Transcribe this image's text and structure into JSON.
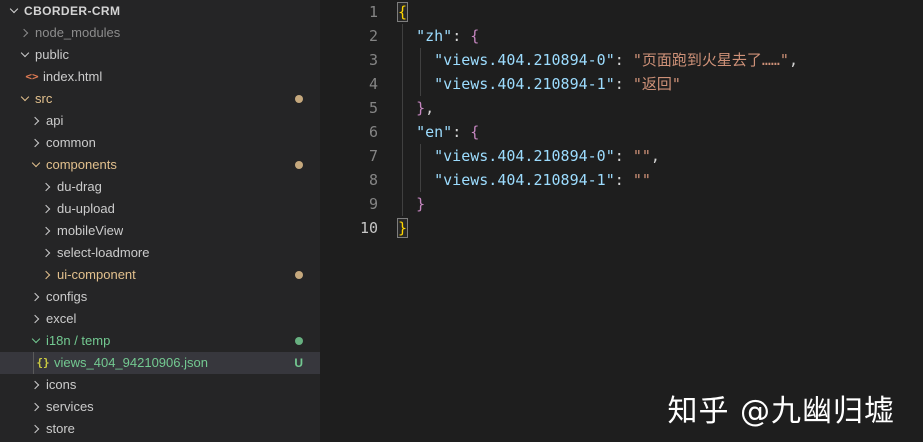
{
  "explorer": {
    "root": {
      "label": "CBORDER-CRM"
    },
    "items": [
      {
        "id": "node-modules",
        "label": "node_modules",
        "depth": 1,
        "kind": "folder",
        "chevron": "right",
        "color": "ignored"
      },
      {
        "id": "public",
        "label": "public",
        "depth": 1,
        "kind": "folder",
        "chevron": "down",
        "color": "normal"
      },
      {
        "id": "index-html",
        "label": "index.html",
        "depth": 2,
        "kind": "file",
        "icon": "html",
        "color": "normal"
      },
      {
        "id": "src",
        "label": "src",
        "depth": 1,
        "kind": "folder",
        "chevron": "down",
        "color": "modified",
        "badge": "dot"
      },
      {
        "id": "api",
        "label": "api",
        "depth": 2,
        "kind": "folder",
        "chevron": "right",
        "color": "normal"
      },
      {
        "id": "common",
        "label": "common",
        "depth": 2,
        "kind": "folder",
        "chevron": "right",
        "color": "normal"
      },
      {
        "id": "components",
        "label": "components",
        "depth": 2,
        "kind": "folder",
        "chevron": "down",
        "color": "modified",
        "badge": "dot"
      },
      {
        "id": "du-drag",
        "label": "du-drag",
        "depth": 3,
        "kind": "folder",
        "chevron": "right",
        "color": "normal"
      },
      {
        "id": "du-upload",
        "label": "du-upload",
        "depth": 3,
        "kind": "folder",
        "chevron": "right",
        "color": "normal"
      },
      {
        "id": "mobileview",
        "label": "mobileView",
        "depth": 3,
        "kind": "folder",
        "chevron": "right",
        "color": "normal"
      },
      {
        "id": "select-loadmore",
        "label": "select-loadmore",
        "depth": 3,
        "kind": "folder",
        "chevron": "right",
        "color": "normal"
      },
      {
        "id": "ui-component",
        "label": "ui-component",
        "depth": 3,
        "kind": "folder",
        "chevron": "right",
        "color": "modified",
        "badge": "dot"
      },
      {
        "id": "configs",
        "label": "configs",
        "depth": 2,
        "kind": "folder",
        "chevron": "right",
        "color": "normal"
      },
      {
        "id": "excel",
        "label": "excel",
        "depth": 2,
        "kind": "folder",
        "chevron": "right",
        "color": "normal"
      },
      {
        "id": "i18n-temp",
        "label": "i18n / temp",
        "depth": 2,
        "kind": "folder",
        "chevron": "down",
        "color": "untracked",
        "badge": "dot"
      },
      {
        "id": "views-404-json",
        "label": "views_404_94210906.json",
        "depth": 3,
        "kind": "file",
        "icon": "json",
        "color": "untracked",
        "badge": "U",
        "selected": true
      },
      {
        "id": "icons",
        "label": "icons",
        "depth": 2,
        "kind": "folder",
        "chevron": "right",
        "color": "normal"
      },
      {
        "id": "services",
        "label": "services",
        "depth": 2,
        "kind": "folder",
        "chevron": "right",
        "color": "normal"
      },
      {
        "id": "store",
        "label": "store",
        "depth": 2,
        "kind": "folder",
        "chevron": "right",
        "color": "normal"
      }
    ]
  },
  "icons": {
    "html": "<>",
    "json": "{}"
  },
  "editor": {
    "lines": [
      {
        "num": "1",
        "active": false,
        "tokens": [
          {
            "text": "{",
            "style": "b1",
            "match": true
          }
        ]
      },
      {
        "num": "2",
        "active": false,
        "tokens": [
          {
            "text": "  ",
            "style": "p"
          },
          {
            "text": "\"zh\"",
            "style": "key"
          },
          {
            "text": ": ",
            "style": "p"
          },
          {
            "text": "{",
            "style": "b2"
          }
        ]
      },
      {
        "num": "3",
        "active": false,
        "tokens": [
          {
            "text": "    ",
            "style": "p"
          },
          {
            "text": "\"views.404.210894-0\"",
            "style": "key"
          },
          {
            "text": ": ",
            "style": "p"
          },
          {
            "text": "\"页面跑到火星去了……\"",
            "style": "str"
          },
          {
            "text": ",",
            "style": "p"
          }
        ]
      },
      {
        "num": "4",
        "active": false,
        "tokens": [
          {
            "text": "    ",
            "style": "p"
          },
          {
            "text": "\"views.404.210894-1\"",
            "style": "key"
          },
          {
            "text": ": ",
            "style": "p"
          },
          {
            "text": "\"返回\"",
            "style": "str"
          }
        ]
      },
      {
        "num": "5",
        "active": false,
        "tokens": [
          {
            "text": "  ",
            "style": "p"
          },
          {
            "text": "}",
            "style": "b2"
          },
          {
            "text": ",",
            "style": "p"
          }
        ]
      },
      {
        "num": "6",
        "active": false,
        "tokens": [
          {
            "text": "  ",
            "style": "p"
          },
          {
            "text": "\"en\"",
            "style": "key"
          },
          {
            "text": ": ",
            "style": "p"
          },
          {
            "text": "{",
            "style": "b2"
          }
        ]
      },
      {
        "num": "7",
        "active": false,
        "tokens": [
          {
            "text": "    ",
            "style": "p"
          },
          {
            "text": "\"views.404.210894-0\"",
            "style": "key"
          },
          {
            "text": ": ",
            "style": "p"
          },
          {
            "text": "\"\"",
            "style": "str"
          },
          {
            "text": ",",
            "style": "p"
          }
        ]
      },
      {
        "num": "8",
        "active": false,
        "tokens": [
          {
            "text": "    ",
            "style": "p"
          },
          {
            "text": "\"views.404.210894-1\"",
            "style": "key"
          },
          {
            "text": ": ",
            "style": "p"
          },
          {
            "text": "\"\"",
            "style": "str"
          }
        ]
      },
      {
        "num": "9",
        "active": false,
        "tokens": [
          {
            "text": "  ",
            "style": "p"
          },
          {
            "text": "}",
            "style": "b2"
          }
        ]
      },
      {
        "num": "10",
        "active": true,
        "tokens": [
          {
            "text": "}",
            "style": "b1",
            "match": true
          }
        ]
      }
    ]
  },
  "watermark": {
    "text": "知乎 @九幽归墟"
  },
  "colors": {
    "sidebar_bg": "#252526",
    "editor_bg": "#1e1e1e",
    "selection_bg": "#37373d",
    "git_modified": "#e2c08d",
    "git_untracked": "#73c991",
    "git_ignored": "#8c8c8c",
    "json_key": "#9cdcfe",
    "json_string": "#ce9178",
    "bracket_outer": "#ffd700",
    "bracket_inner": "#c586c0",
    "line_number": "#858585"
  }
}
